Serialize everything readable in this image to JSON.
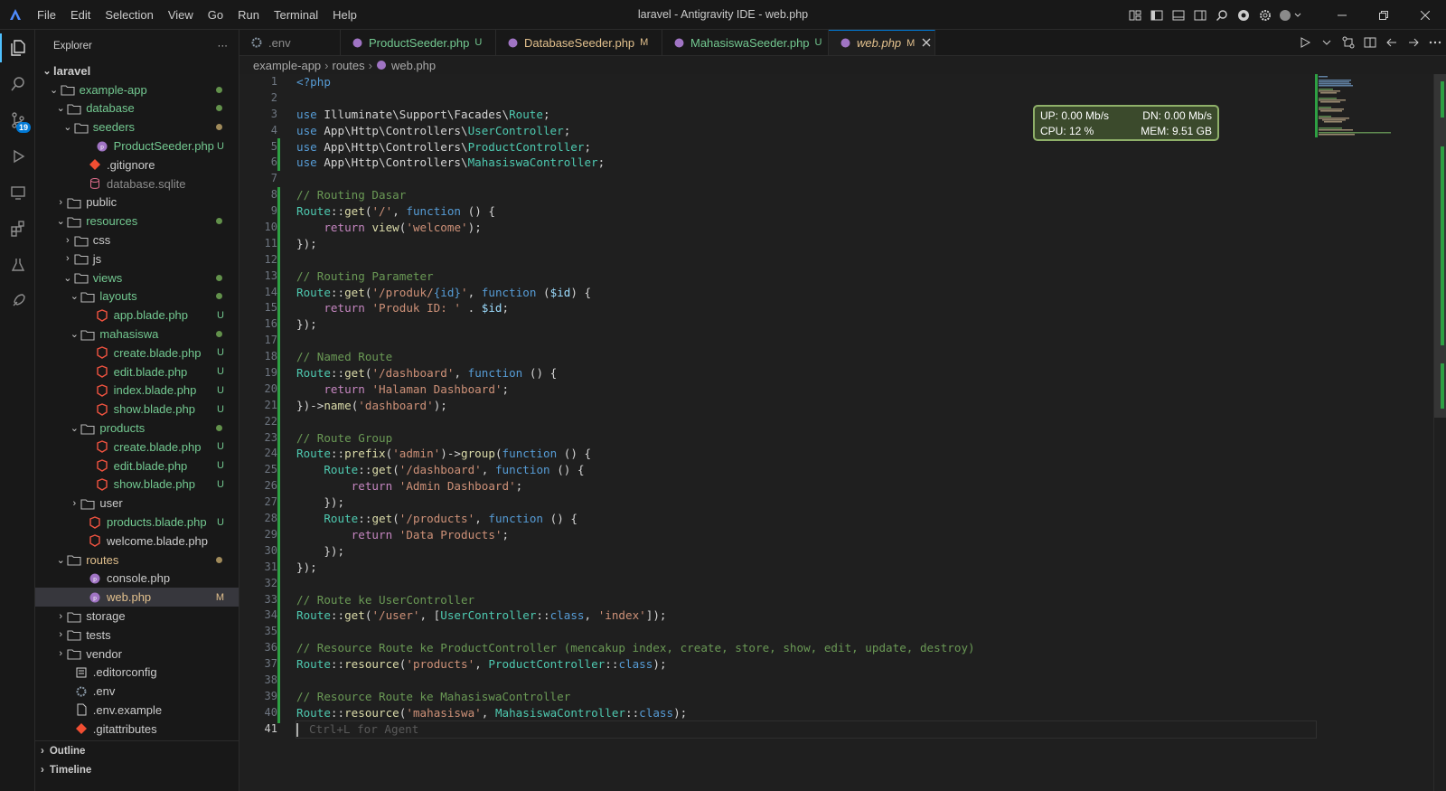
{
  "titlebar": {
    "menu": [
      "File",
      "Edit",
      "Selection",
      "View",
      "Go",
      "Run",
      "Terminal",
      "Help"
    ],
    "title": "laravel - Antigravity IDE - web.php"
  },
  "activity": {
    "source_control_badge": "19"
  },
  "explorer": {
    "header": "Explorer",
    "more": "···",
    "rows": [
      {
        "label": "laravel",
        "kind": "root"
      },
      {
        "label": "example-app",
        "kind": "folder"
      },
      {
        "label": "database",
        "kind": "folder"
      },
      {
        "label": "seeders",
        "kind": "folder"
      },
      {
        "label": "ProductSeeder.php",
        "kind": "php",
        "status": "U"
      },
      {
        "label": ".gitignore",
        "kind": "git"
      },
      {
        "label": "database.sqlite",
        "kind": "db"
      },
      {
        "label": "public",
        "kind": "folder"
      },
      {
        "label": "resources",
        "kind": "folder"
      },
      {
        "label": "css",
        "kind": "folder"
      },
      {
        "label": "js",
        "kind": "folder"
      },
      {
        "label": "views",
        "kind": "folder"
      },
      {
        "label": "layouts",
        "kind": "folder"
      },
      {
        "label": "app.blade.php",
        "kind": "blade",
        "status": "U"
      },
      {
        "label": "mahasiswa",
        "kind": "folder"
      },
      {
        "label": "create.blade.php",
        "kind": "blade",
        "status": "U"
      },
      {
        "label": "edit.blade.php",
        "kind": "blade",
        "status": "U"
      },
      {
        "label": "index.blade.php",
        "kind": "blade",
        "status": "U"
      },
      {
        "label": "show.blade.php",
        "kind": "blade",
        "status": "U"
      },
      {
        "label": "products",
        "kind": "folder"
      },
      {
        "label": "create.blade.php",
        "kind": "blade",
        "status": "U"
      },
      {
        "label": "edit.blade.php",
        "kind": "blade",
        "status": "U"
      },
      {
        "label": "show.blade.php",
        "kind": "blade",
        "status": "U"
      },
      {
        "label": "user",
        "kind": "folder"
      },
      {
        "label": "products.blade.php",
        "kind": "blade",
        "status": "U"
      },
      {
        "label": "welcome.blade.php",
        "kind": "blade"
      },
      {
        "label": "routes",
        "kind": "folder"
      },
      {
        "label": "console.php",
        "kind": "php"
      },
      {
        "label": "web.php",
        "kind": "php",
        "status": "M"
      },
      {
        "label": "storage",
        "kind": "folder"
      },
      {
        "label": "tests",
        "kind": "folder"
      },
      {
        "label": "vendor",
        "kind": "folder"
      },
      {
        "label": ".editorconfig",
        "kind": "config"
      },
      {
        "label": ".env",
        "kind": "gear"
      },
      {
        "label": ".env.example",
        "kind": "file"
      },
      {
        "label": ".gitattributes",
        "kind": "git"
      }
    ],
    "outline": "Outline",
    "timeline": "Timeline"
  },
  "tabs": [
    {
      "label": ".env",
      "status": "",
      "icon": "gear"
    },
    {
      "label": "ProductSeeder.php",
      "status": "U",
      "icon": "php"
    },
    {
      "label": "DatabaseSeeder.php",
      "status": "M",
      "icon": "php"
    },
    {
      "label": "MahasiswaSeeder.php",
      "status": "U",
      "icon": "php"
    },
    {
      "label": "web.php",
      "status": "M",
      "icon": "php"
    }
  ],
  "breadcrumb": [
    "example-app",
    "routes",
    "web.php"
  ],
  "editor": {
    "current_line": "41",
    "ghost_hint": "Ctrl+L for Agent",
    "lines": [
      "1",
      "2",
      "3",
      "4",
      "5",
      "6",
      "7",
      "8",
      "9",
      "10",
      "11",
      "12",
      "13",
      "14",
      "15",
      "16",
      "17",
      "18",
      "19",
      "20",
      "21",
      "22",
      "23",
      "24",
      "25",
      "26",
      "27",
      "28",
      "29",
      "30",
      "31",
      "32",
      "33",
      "34",
      "35",
      "36",
      "37",
      "38",
      "39",
      "40",
      "41"
    ]
  },
  "netmon": {
    "up": "UP: 0.00 Mb/s",
    "dn": "DN: 0.00 Mb/s",
    "cpu": "CPU: 12 %",
    "mem": "MEM: 9.51 GB"
  },
  "colors": {
    "accent": "#0078d4",
    "untracked": "#73c991",
    "modified": "#e2c08d",
    "added_gutter": "#2ea043"
  }
}
